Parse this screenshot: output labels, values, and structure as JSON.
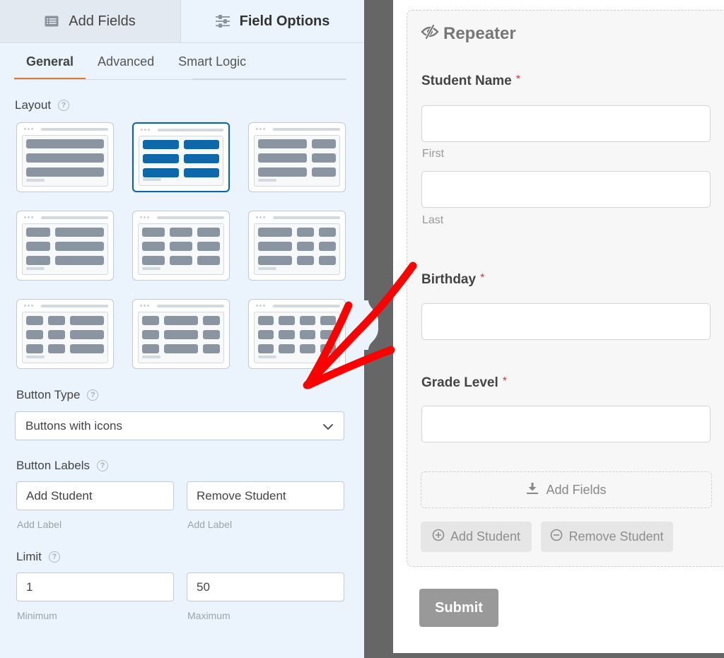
{
  "top_tabs": [
    {
      "label": "Add Fields",
      "icon": "list-icon",
      "active": false
    },
    {
      "label": "Field Options",
      "icon": "sliders-icon",
      "active": true
    }
  ],
  "sub_tabs": [
    {
      "label": "General",
      "active": true
    },
    {
      "label": "Advanced",
      "active": false
    },
    {
      "label": "Smart Logic",
      "active": false
    }
  ],
  "layout": {
    "label": "Layout",
    "help_icon": "?",
    "selected_index": 1,
    "options": [
      {
        "name": "one-column",
        "columns": [
          1
        ]
      },
      {
        "name": "two-halves",
        "columns": [
          1,
          1
        ]
      },
      {
        "name": "two-thirds-one-third",
        "columns": [
          2,
          1
        ]
      },
      {
        "name": "one-third-two-thirds",
        "columns": [
          1,
          2
        ]
      },
      {
        "name": "three-thirds",
        "columns": [
          1,
          1,
          1
        ]
      },
      {
        "name": "half-quarter-quarter",
        "columns": [
          2,
          1,
          1
        ]
      },
      {
        "name": "quarter-quarter-half",
        "columns": [
          1,
          1,
          2
        ]
      },
      {
        "name": "quarter-half-quarter",
        "columns": [
          1,
          2,
          1
        ]
      },
      {
        "name": "four-quarters",
        "columns": [
          1,
          1,
          1,
          1
        ]
      }
    ]
  },
  "button_type": {
    "label": "Button Type",
    "help_icon": "?",
    "selected": "Buttons with icons"
  },
  "button_labels": {
    "label": "Button Labels",
    "help_icon": "?",
    "add_value": "Add Student",
    "add_sublabel": "Add Label",
    "remove_value": "Remove Student",
    "remove_sublabel": "Add Label"
  },
  "limit": {
    "label": "Limit",
    "help_icon": "?",
    "min_value": "1",
    "min_sublabel": "Minimum",
    "max_value": "50",
    "max_sublabel": "Maximum"
  },
  "preview": {
    "repeater_title": "Repeater",
    "fields": [
      {
        "label": "Student Name",
        "required": "*",
        "sublabels": [
          "First",
          "Last"
        ]
      },
      {
        "label": "Birthday",
        "required": "*"
      },
      {
        "label": "Grade Level",
        "required": "*"
      }
    ],
    "add_fields_label": "Add Fields",
    "add_button": "Add Student",
    "remove_button": "Remove Student",
    "submit_label": "Submit"
  },
  "colors": {
    "accent_tab": "#e27730",
    "selected_layout": "#0e66ab",
    "required": "#d63637",
    "annotation_arrow": "#ff0000"
  }
}
